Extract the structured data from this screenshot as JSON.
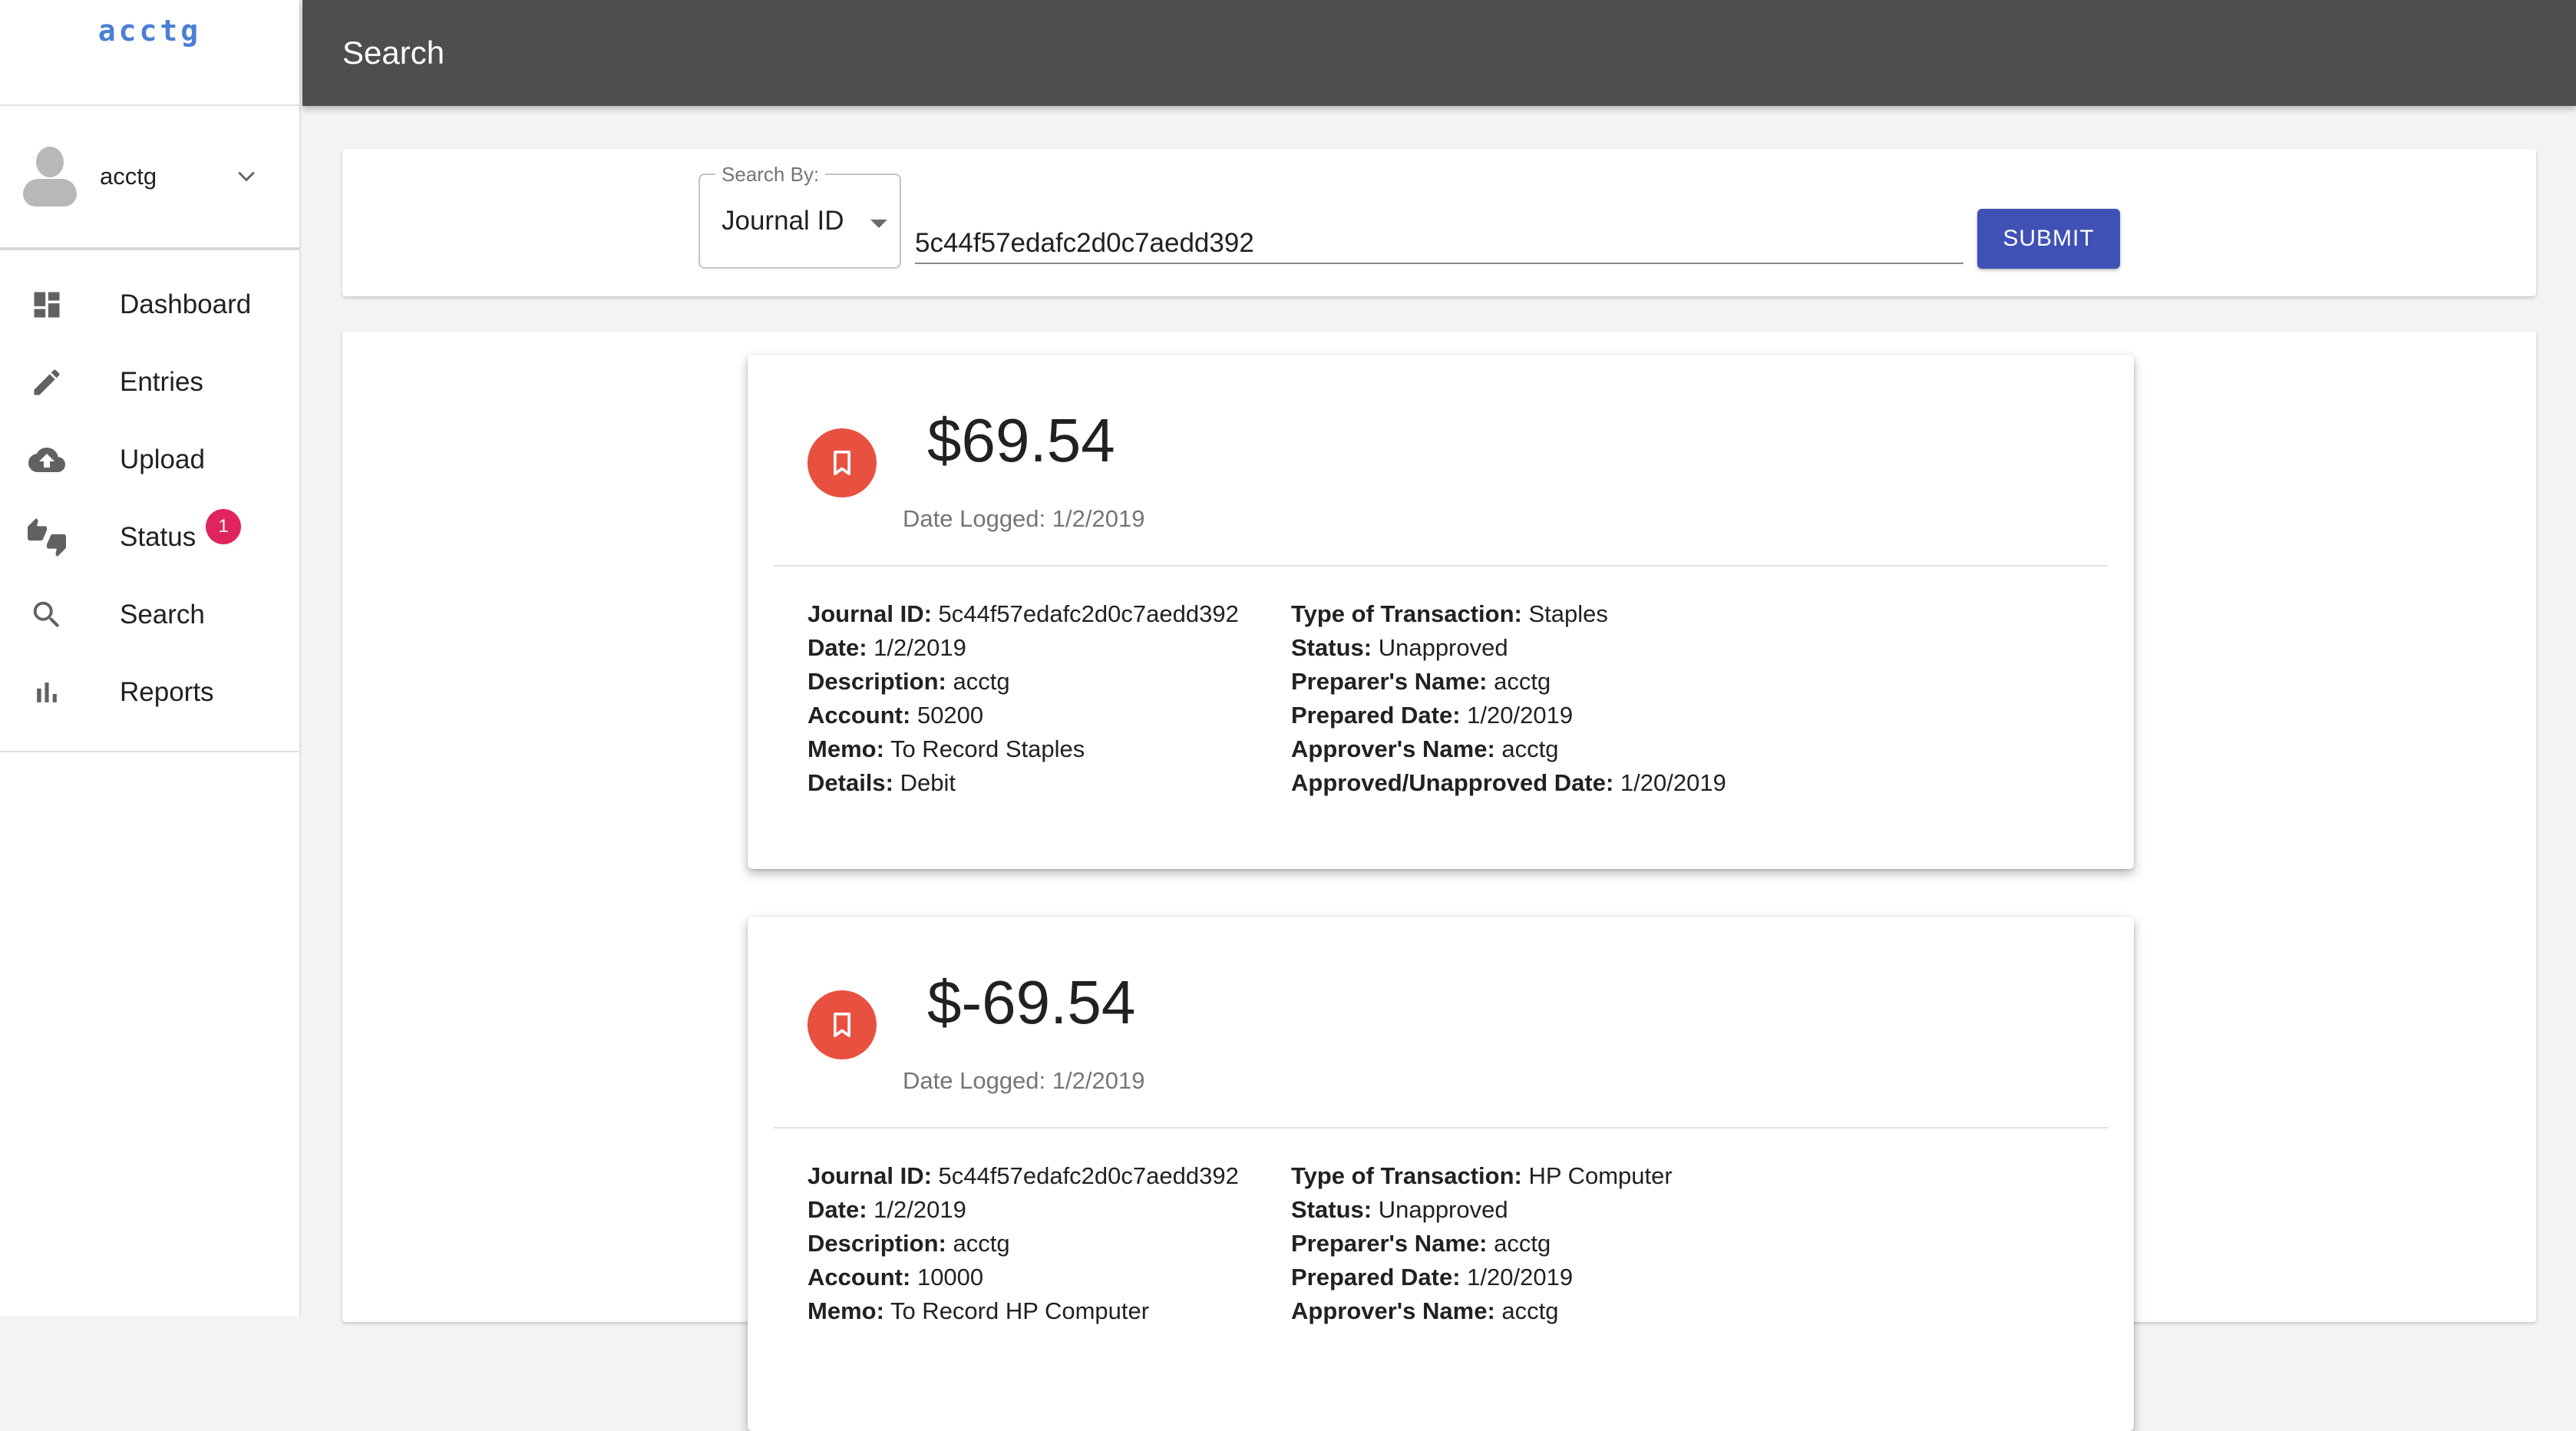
{
  "app": {
    "logo": "acctg"
  },
  "user": {
    "name": "acctg"
  },
  "nav": [
    {
      "label": "Dashboard",
      "icon": "dashboard-icon"
    },
    {
      "label": "Entries",
      "icon": "pencil-icon"
    },
    {
      "label": "Upload",
      "icon": "cloud-upload-icon"
    },
    {
      "label": "Status",
      "icon": "thumbs-up-down-icon",
      "badge": "1"
    },
    {
      "label": "Search",
      "icon": "search-icon"
    },
    {
      "label": "Reports",
      "icon": "bar-chart-icon"
    }
  ],
  "header": {
    "title": "Search"
  },
  "search": {
    "by_label": "Search By:",
    "by_value": "Journal ID",
    "query": "5c44f57edafc2d0c7aedd392",
    "submit_label": "SUBMIT"
  },
  "colors": {
    "accent": "#3f51b5",
    "topbar": "#4e4e4e",
    "entry_icon": "#e8513f",
    "badge": "#e0245e"
  },
  "labels": {
    "date_logged": "Date Logged:",
    "journal_id": "Journal ID:",
    "date": "Date:",
    "description": "Description:",
    "account": "Account:",
    "memo": "Memo:",
    "details": "Details:",
    "type": "Type of Transaction:",
    "status": "Status:",
    "preparer": "Preparer's Name:",
    "prepared_date": "Prepared Date:",
    "approver": "Approver's Name:",
    "approved_date": "Approved/Unapproved Date:"
  },
  "results": [
    {
      "amount": "$69.54",
      "date_logged": "1/2/2019",
      "journal_id": "5c44f57edafc2d0c7aedd392",
      "date": "1/2/2019",
      "description": "acctg",
      "account": "50200",
      "memo": "To Record Staples",
      "details": "Debit",
      "type": "Staples",
      "status": "Unapproved",
      "preparer": "acctg",
      "prepared_date": "1/20/2019",
      "approver": "acctg",
      "approved_date": "1/20/2019"
    },
    {
      "amount": "$-69.54",
      "date_logged": "1/2/2019",
      "journal_id": "5c44f57edafc2d0c7aedd392",
      "date": "1/2/2019",
      "description": "acctg",
      "account": "10000",
      "memo": "To Record HP Computer",
      "type": "HP Computer",
      "status": "Unapproved",
      "preparer": "acctg",
      "prepared_date": "1/20/2019",
      "approver": "acctg"
    }
  ]
}
